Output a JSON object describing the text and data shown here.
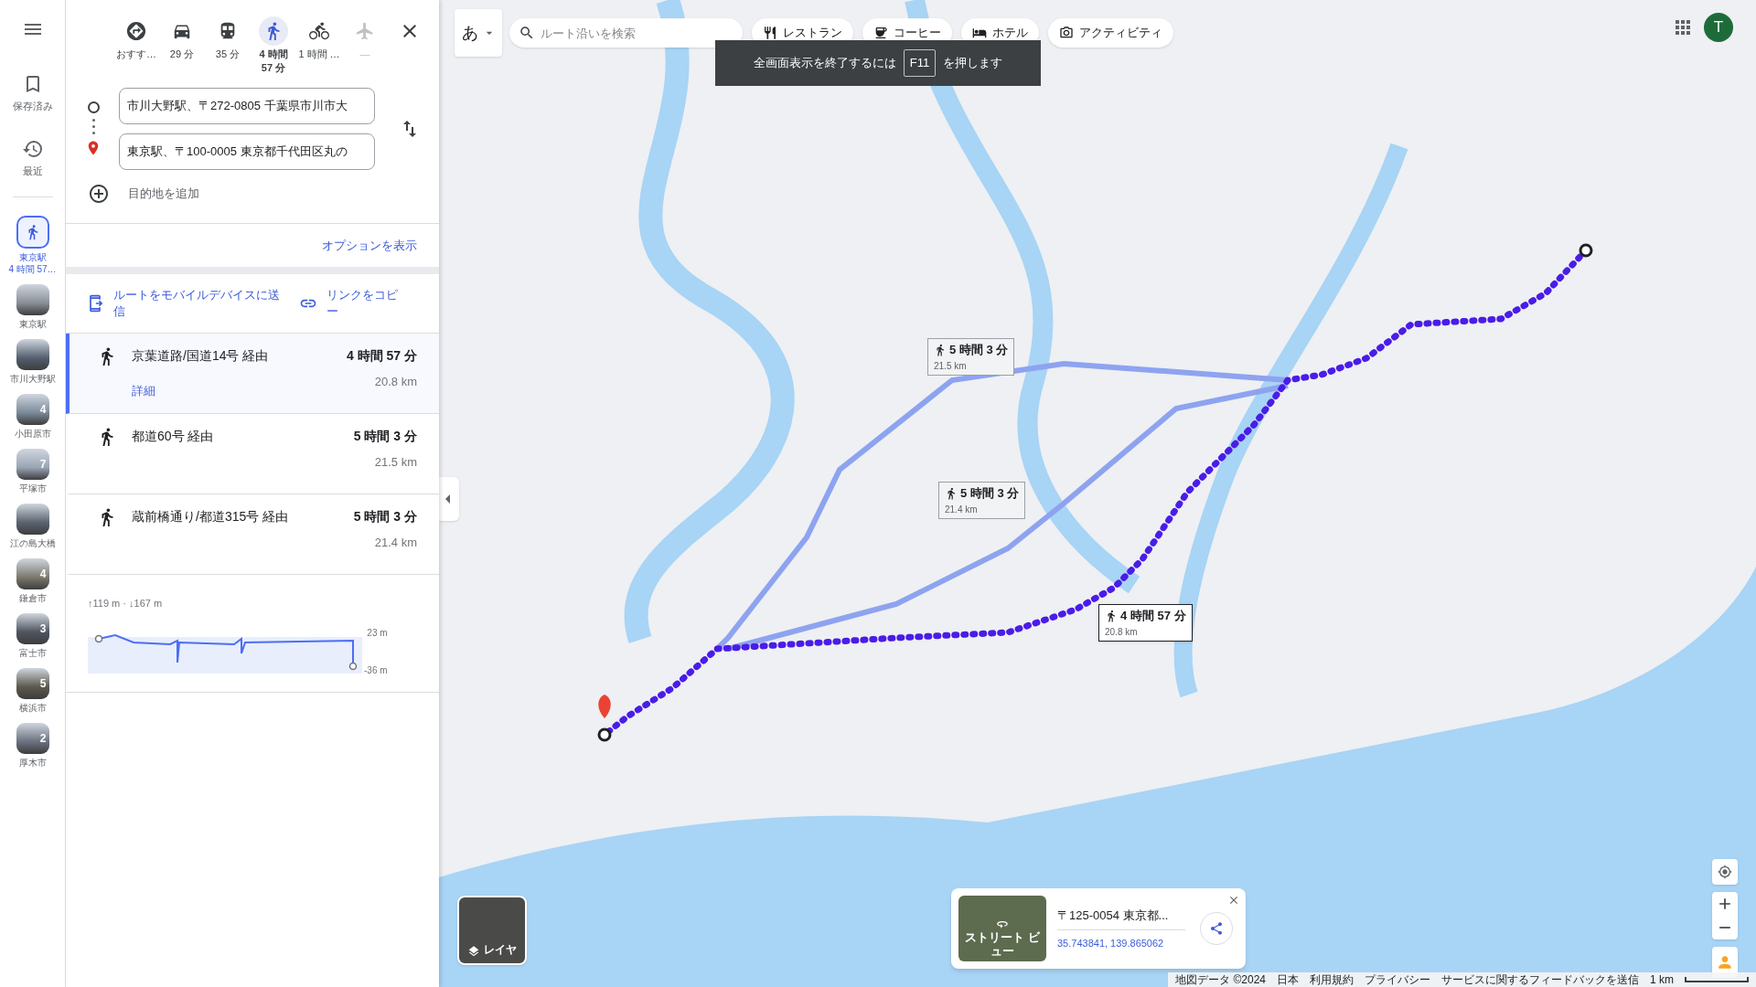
{
  "rail": {
    "nav": [
      {
        "kind": "saved",
        "label": "保存済み"
      },
      {
        "kind": "recent",
        "label": "最近"
      }
    ],
    "history": [
      {
        "kind": "route",
        "lines": [
          "東京駅",
          "4 時間 57…"
        ],
        "selected": true
      },
      {
        "kind": "place",
        "lines": [
          "東京駅"
        ],
        "selected": false
      },
      {
        "kind": "place",
        "lines": [
          "市川大野駅"
        ],
        "selected": false
      },
      {
        "kind": "place",
        "lines": [
          "小田原市"
        ],
        "badge": "4",
        "selected": false
      },
      {
        "kind": "place",
        "lines": [
          "平塚市"
        ],
        "badge": "7",
        "selected": false
      },
      {
        "kind": "place",
        "lines": [
          "江の島大橋"
        ],
        "selected": false
      },
      {
        "kind": "place",
        "lines": [
          "鎌倉市"
        ],
        "badge": "4",
        "selected": false
      },
      {
        "kind": "place",
        "lines": [
          "富士市"
        ],
        "badge": "3",
        "selected": false
      },
      {
        "kind": "place",
        "lines": [
          "横浜市"
        ],
        "badge": "5",
        "selected": false
      },
      {
        "kind": "place",
        "lines": [
          "厚木市"
        ],
        "badge": "2",
        "selected": false
      }
    ]
  },
  "directions": {
    "travel_modes": [
      {
        "kind": "best",
        "label": "おすす…",
        "selected": false,
        "disabled": false
      },
      {
        "kind": "car",
        "label": "29 分",
        "selected": false,
        "disabled": false
      },
      {
        "kind": "transit",
        "label": "35 分",
        "selected": false,
        "disabled": false
      },
      {
        "kind": "walk",
        "label": "4 時間 57 分",
        "selected": true,
        "disabled": false
      },
      {
        "kind": "bike",
        "label": "1 時間 …",
        "selected": false,
        "disabled": false
      },
      {
        "kind": "flight",
        "label": "—",
        "selected": false,
        "disabled": true
      }
    ],
    "origin": {
      "value": "市川大野駅、〒272-0805 千葉県市川市大"
    },
    "destination": {
      "value": "東京駅、〒100-0005 東京都千代田区丸の"
    },
    "add_destination": "目的地を追加",
    "options_link": "オプションを表示",
    "send_to_mobile": "ルートをモバイルデバイスに送信",
    "copy_link": "リンクをコピー",
    "routes": [
      {
        "via": "京葉道路/国道14号 経由",
        "duration": "4 時間 57 分",
        "distance": "20.8 km",
        "details": "詳細",
        "selected": true
      },
      {
        "via": "都道60号 経由",
        "duration": "5 時間 3 分",
        "distance": "21.5 km",
        "selected": false
      },
      {
        "via": "蔵前橋通り/都道315号 経由",
        "duration": "5 時間 3 分",
        "distance": "21.4 km",
        "selected": false
      }
    ],
    "elevation": {
      "summary": "↑119 m · ↓167 m",
      "max_label": "23 m",
      "min_label": "-36 m"
    }
  },
  "map": {
    "input_tool": "あ",
    "search": {
      "placeholder": "ルート沿いを検索"
    },
    "chips": [
      {
        "kind": "restaurant",
        "label": "レストラン"
      },
      {
        "kind": "coffee",
        "label": "コーヒー"
      },
      {
        "kind": "hotel",
        "label": "ホテル"
      },
      {
        "kind": "activity",
        "label": "アクティビティ"
      }
    ],
    "fullscreen_toast": {
      "before": "全画面表示を終了するには",
      "key": "F11",
      "after": "を押します"
    },
    "avatar": "T",
    "route_labels": [
      {
        "duration": "5 時間 3 分",
        "distance": "21.5 km",
        "selected": false
      },
      {
        "duration": "5 時間 3 分",
        "distance": "21.4 km",
        "selected": false
      },
      {
        "duration": "4 時間 57 分",
        "distance": "20.8 km",
        "selected": true
      }
    ],
    "layers_button": "レイヤ",
    "info_card": {
      "title": "〒125-0054 東京都...",
      "coordinates": "35.743841, 139.865062",
      "street_view": "ストリート ビュー"
    },
    "footer": [
      "地図データ ©2024",
      "日本",
      "利用規約",
      "プライバシー",
      "サービスに関するフィードバックを送信"
    ],
    "scale": "1 km"
  }
}
